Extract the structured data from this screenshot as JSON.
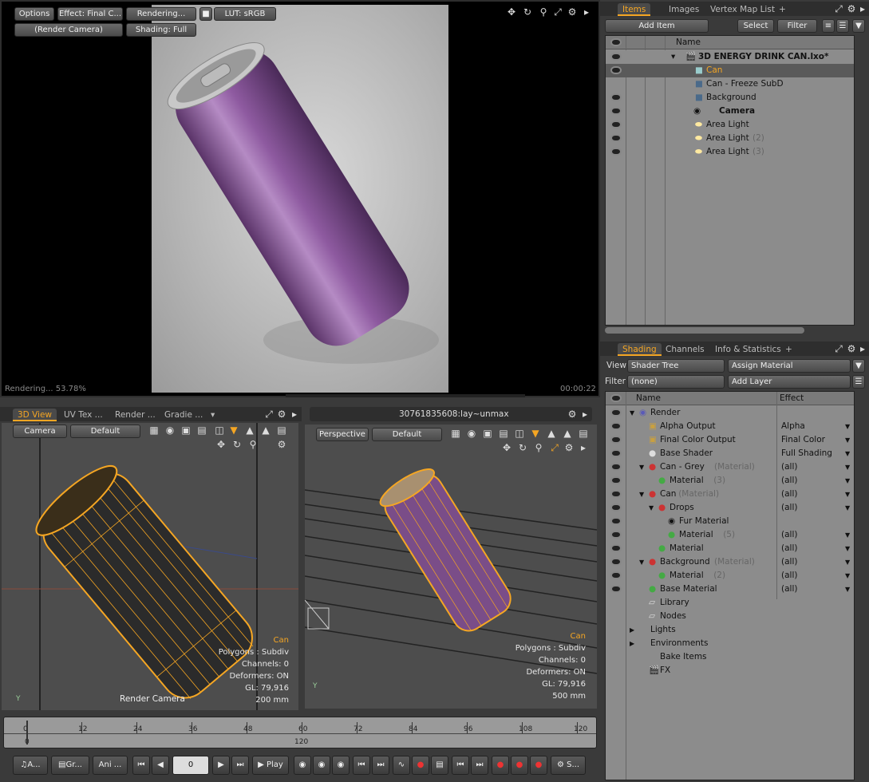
{
  "render_view": {
    "options": "Options",
    "effect": "Effect: Final C...",
    "rendering": "Rendering...",
    "lut": "LUT: sRGB",
    "camera": "(Render Camera)",
    "shading": "Shading: Full",
    "status": "Rendering... 53.78%",
    "time": "00:00:22"
  },
  "items_panel": {
    "tabs": [
      "Items",
      "Images",
      "Vertex Map List"
    ],
    "add_item": "Add Item",
    "select": "Select",
    "filter": "Filter",
    "col_name": "Name",
    "rows": [
      {
        "label": "3D ENERGY DRINK CAN.lxo*",
        "extra": ""
      },
      {
        "label": "Can",
        "extra": ""
      },
      {
        "label": "Can - Freeze SubD",
        "extra": ""
      },
      {
        "label": "Background",
        "extra": ""
      },
      {
        "label": "Camera",
        "extra": ""
      },
      {
        "label": "Area Light",
        "extra": ""
      },
      {
        "label": "Area Light",
        "extra": "(2)"
      },
      {
        "label": "Area Light",
        "extra": "(3)"
      }
    ]
  },
  "shading_panel": {
    "tabs": [
      "Shading",
      "Channels",
      "Info & Statistics"
    ],
    "view_label": "View",
    "view_value": "Shader Tree",
    "assign": "Assign Material",
    "filter_label": "Filter",
    "filter_value": "(none)",
    "add_layer": "Add Layer",
    "col_name": "Name",
    "col_effect": "Effect",
    "rows": [
      {
        "label": "Render",
        "extra": "",
        "effect": ""
      },
      {
        "label": "Alpha Output",
        "extra": "",
        "effect": "Alpha"
      },
      {
        "label": "Final Color Output",
        "extra": "",
        "effect": "Final Color"
      },
      {
        "label": "Base Shader",
        "extra": "",
        "effect": "Full Shading"
      },
      {
        "label": "Can - Grey",
        "extra": "(Material)",
        "effect": "(all)"
      },
      {
        "label": "Material",
        "extra": "(3)",
        "effect": "(all)"
      },
      {
        "label": "Can",
        "extra": "(Material)",
        "effect": "(all)"
      },
      {
        "label": "Drops",
        "extra": "",
        "effect": "(all)"
      },
      {
        "label": "Fur Material",
        "extra": "",
        "effect": ""
      },
      {
        "label": "Material",
        "extra": "(5)",
        "effect": "(all)"
      },
      {
        "label": "Material",
        "extra": "",
        "effect": "(all)"
      },
      {
        "label": "Background",
        "extra": "(Material)",
        "effect": "(all)"
      },
      {
        "label": "Material",
        "extra": "(2)",
        "effect": "(all)"
      },
      {
        "label": "Base Material",
        "extra": "",
        "effect": "(all)"
      },
      {
        "label": "Library",
        "extra": "",
        "effect": ""
      },
      {
        "label": "Nodes",
        "extra": "",
        "effect": ""
      },
      {
        "label": "Lights",
        "extra": "",
        "effect": ""
      },
      {
        "label": "Environments",
        "extra": "",
        "effect": ""
      },
      {
        "label": "Bake Items",
        "extra": "",
        "effect": ""
      },
      {
        "label": "FX",
        "extra": "",
        "effect": ""
      }
    ]
  },
  "view3d": {
    "tabs": [
      "3D View",
      "UV Tex ...",
      "Render ...",
      "Gradie ..."
    ],
    "camera": "Camera",
    "default": "Default",
    "info": [
      "Can",
      "Polygons : Subdiv",
      "Channels: 0",
      "Deformers: ON",
      "GL: 79,916",
      "200 mm"
    ],
    "footer": "Render Camera"
  },
  "persp_view": {
    "title": "30761835608:lay~unmax",
    "view": "Perspective",
    "default": "Default",
    "info": [
      "Can",
      "Polygons : Subdiv",
      "Channels: 0",
      "Deformers: ON",
      "GL: 79,916",
      "500 mm"
    ]
  },
  "timeline": {
    "ticks": [
      "0",
      "12",
      "24",
      "36",
      "48",
      "60",
      "72",
      "84",
      "96",
      "108",
      "120"
    ],
    "lower": [
      "0",
      "120"
    ]
  },
  "transport": {
    "audio": "A...",
    "graph": "Gr...",
    "anim": "Ani ...",
    "frame": "0",
    "play": "Play",
    "script": "S..."
  },
  "colors": {
    "accent": "#f5a623",
    "can": "#9a5fa8"
  }
}
